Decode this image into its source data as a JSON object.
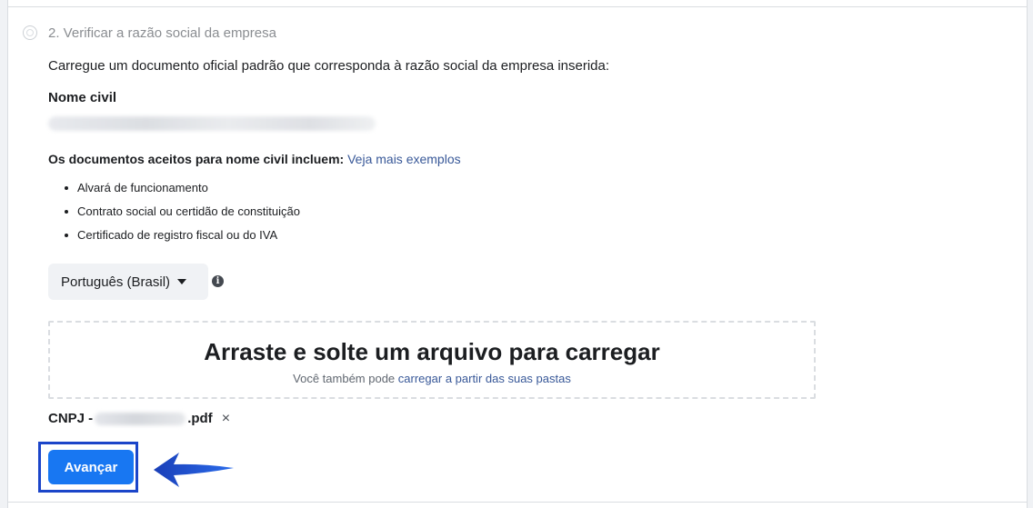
{
  "step": {
    "title": "2. Verificar a razão social da empresa",
    "instruction": "Carregue um documento oficial padrão que corresponda à razão social da empresa inserida:"
  },
  "name_section": {
    "label": "Nome civil"
  },
  "accepted_docs": {
    "intro": "Os documentos aceitos para nome civil incluem:",
    "more_link": "Veja mais exemplos",
    "items": [
      "Alvará de funcionamento",
      "Contrato social ou certidão de constituição",
      "Certificado de registro fiscal ou do IVA"
    ]
  },
  "language_select": {
    "selected": "Português (Brasil)",
    "info_icon": "i"
  },
  "dropzone": {
    "title": "Arraste e solte um arquivo para carregar",
    "sub_prefix": "Você também pode",
    "sub_link": "carregar a partir das suas pastas"
  },
  "file": {
    "prefix": "CNPJ -",
    "suffix": ".pdf",
    "remove": "×"
  },
  "next_button": {
    "label": "Avançar"
  },
  "colors": {
    "primary": "#1877f2",
    "link": "#385898",
    "highlight": "#1b45c9"
  }
}
